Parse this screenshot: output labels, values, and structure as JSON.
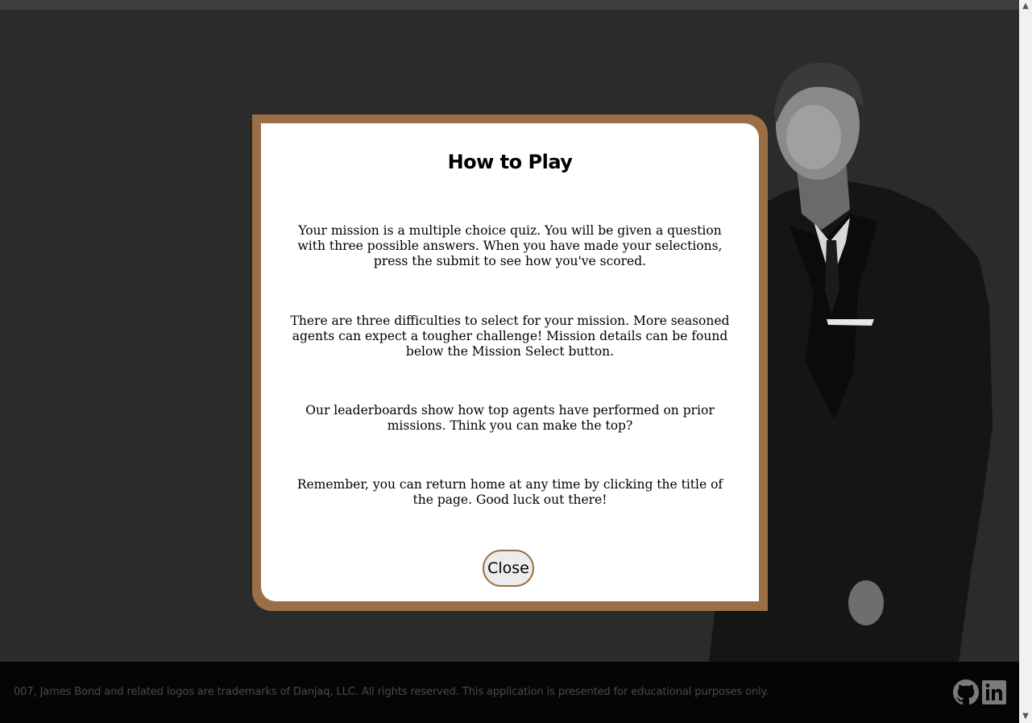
{
  "modal": {
    "title": "How to Play",
    "paragraphs": [
      "Your mission is a multiple choice quiz. You will be given a question with three possible answers. When you have made your selections, press the submit to see how you've scored.",
      "There are three difficulties to select for your mission. More seasoned agents can expect a tougher challenge! Mission details can be found below the Mission Select button.",
      "Our leaderboards show how top agents have performed on prior missions. Think you can make the top?",
      "Remember, you can return home at any time by clicking the title of the page. Good luck out there!"
    ],
    "close_label": "Close"
  },
  "footer": {
    "text": "007, James Bond and related logos are trademarks of Danjaq, LLC. All rights reserved. This application is presented for educational purposes only.",
    "icons": [
      "github-icon",
      "linkedin-icon"
    ]
  },
  "colors": {
    "modal_border": "#9b6f45",
    "background": "#2b2b2b",
    "footer_bg": "#050505"
  }
}
